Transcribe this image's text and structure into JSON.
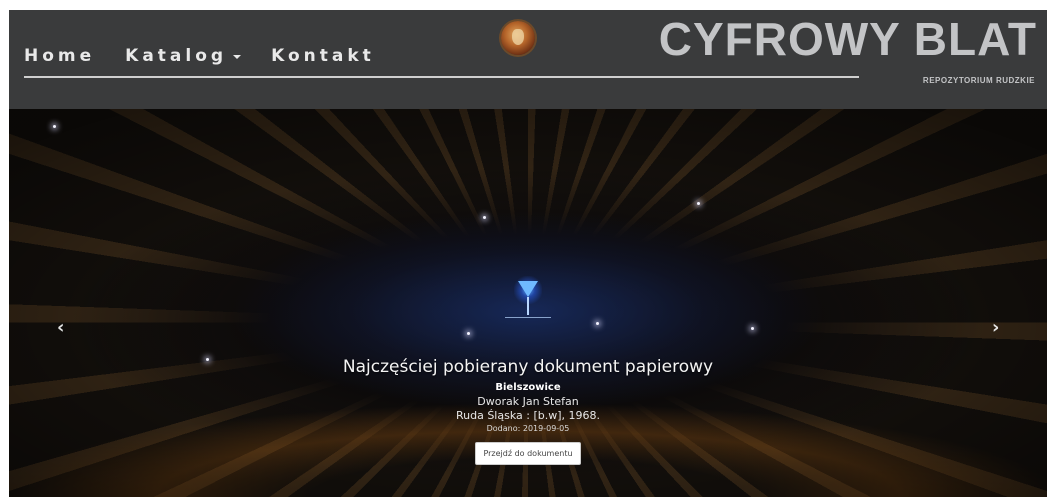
{
  "nav": {
    "items": [
      {
        "label": "Home"
      },
      {
        "label": "Katalog"
      },
      {
        "label": "Kontakt"
      }
    ]
  },
  "brand": {
    "title": "CYFROWY BLAT",
    "subtitle": "REPOZYTORIUM RUDZKIE"
  },
  "carousel": {
    "prev_glyph": "‹",
    "next_glyph": "›",
    "caption": {
      "heading": "Najczęściej pobierany dokument papierowy",
      "title": "Bielszowice",
      "author": "Dworak Jan Stefan",
      "publication": "Ruda Śląska : [b.w], 1968.",
      "added": "Dodano: 2019-09-05",
      "button_label": "Przejdź do dokumentu"
    }
  },
  "colors": {
    "navbar_bg": "#3a3b3c",
    "nav_text": "#e9e9e9",
    "brand_text": "#c3c4c6"
  },
  "icons": {
    "emblem": "coat-of-arms-emblem",
    "prev": "chevron-left-icon",
    "next": "chevron-right-icon",
    "dropdown": "caret-down-icon"
  }
}
